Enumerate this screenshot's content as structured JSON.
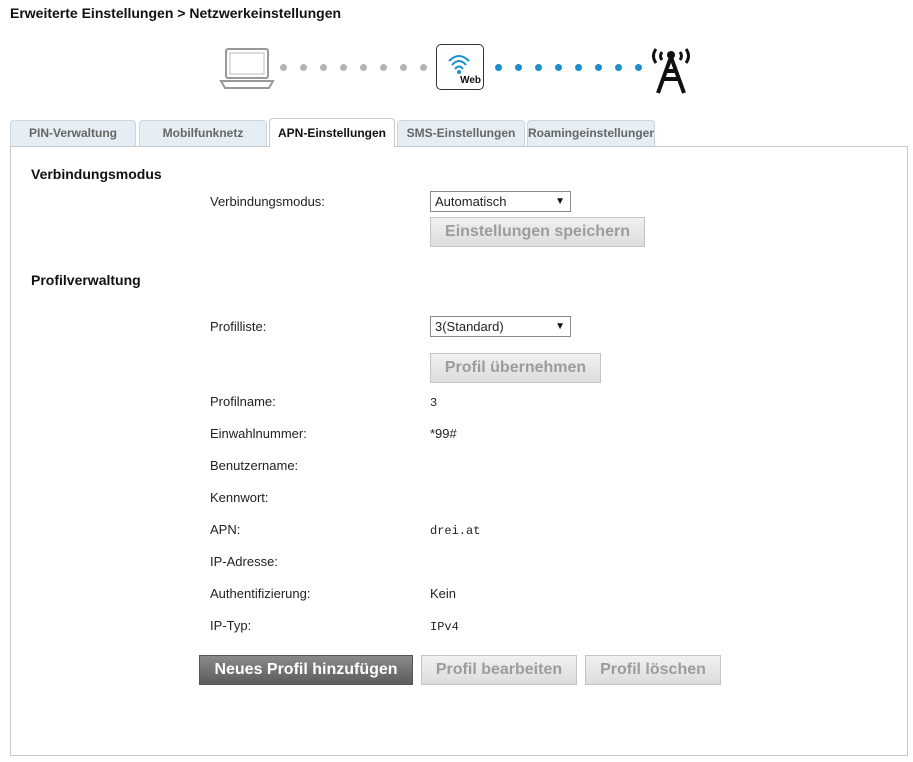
{
  "breadcrumb": "Erweiterte Einstellungen > Netzwerkeinstellungen",
  "diagram": {
    "web_label": "Web",
    "colors": {
      "grey_dots": "#b4b4b4",
      "blue_dots": "#1a8ecf"
    }
  },
  "tabs": [
    {
      "label": "PIN-Verwaltung",
      "active": false
    },
    {
      "label": "Mobilfunknetz",
      "active": false
    },
    {
      "label": "APN-Einstellungen",
      "active": true
    },
    {
      "label": "SMS-Einstellungen",
      "active": false
    },
    {
      "label": "Roamingeinstellungen",
      "active": false
    }
  ],
  "connection": {
    "section_title": "Verbindungsmodus",
    "mode_label": "Verbindungsmodus:",
    "mode_value": "Automatisch",
    "save_button": "Einstellungen speichern"
  },
  "profile": {
    "section_title": "Profilverwaltung",
    "list_label": "Profilliste:",
    "list_value": "3(Standard)",
    "apply_button": "Profil übernehmen",
    "fields": {
      "name_label": "Profilname:",
      "name_value": "3",
      "dial_label": "Einwahlnummer:",
      "dial_value": "*99#",
      "user_label": "Benutzername:",
      "user_value": "",
      "password_label": "Kennwort:",
      "password_value": "",
      "apn_label": "APN:",
      "apn_value": "drei.at",
      "ip_label": "IP-Adresse:",
      "ip_value": "",
      "auth_label": "Authentifizierung:",
      "auth_value": "Kein",
      "iptype_label": "IP-Typ:",
      "iptype_value": "IPv4"
    },
    "add_button": "Neues Profil hinzufügen",
    "edit_button": "Profil bearbeiten",
    "delete_button": "Profil löschen"
  }
}
